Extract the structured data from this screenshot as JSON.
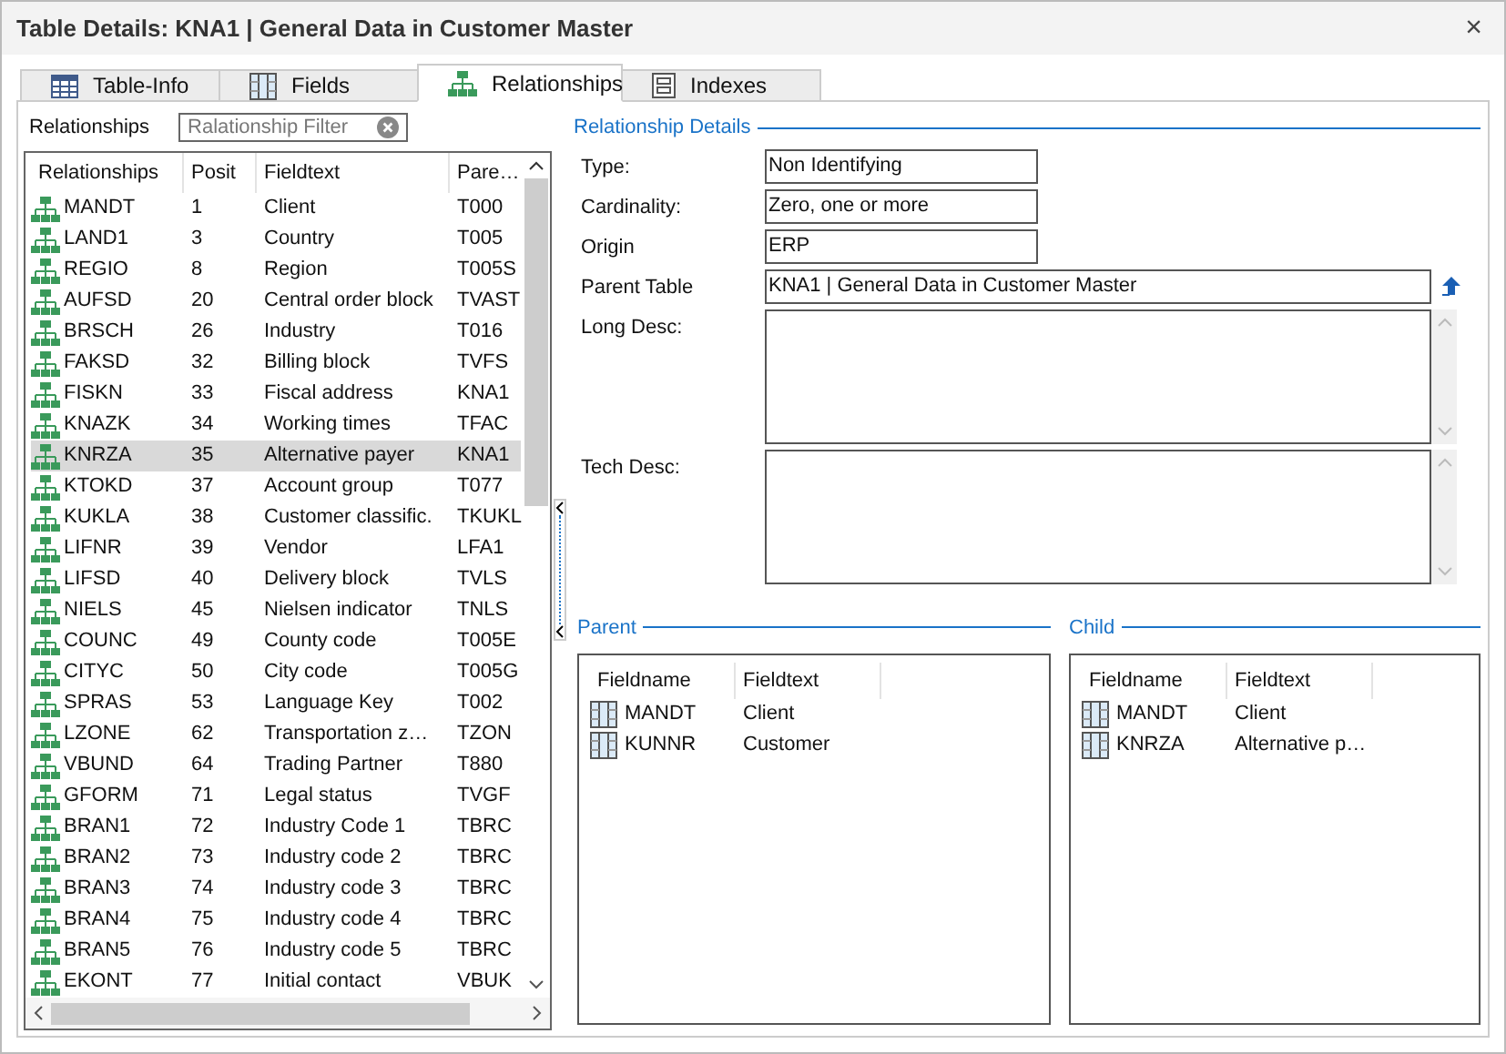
{
  "window": {
    "title": "Table Details: KNA1 | General Data in Customer Master",
    "close": "×"
  },
  "tabs": [
    {
      "label": "Table-Info",
      "kind": "table",
      "selected": false
    },
    {
      "label": "Fields",
      "kind": "fields",
      "selected": false
    },
    {
      "label": "Relationships",
      "kind": "relationships",
      "selected": true
    },
    {
      "label": "Indexes",
      "kind": "indexes",
      "selected": false
    }
  ],
  "relationships_panel": {
    "label": "Relationships",
    "filter": {
      "placeholder": "Ralationship Filter"
    },
    "columns": [
      "Relationships",
      "Posit",
      "Fieldtext",
      "Pare…"
    ],
    "rows": [
      {
        "name": "MANDT",
        "posit": "1",
        "fieldtext": "Client",
        "parent": "T000",
        "selected": false
      },
      {
        "name": "LAND1",
        "posit": "3",
        "fieldtext": "Country",
        "parent": "T005",
        "selected": false
      },
      {
        "name": "REGIO",
        "posit": "8",
        "fieldtext": "Region",
        "parent": "T005S",
        "selected": false
      },
      {
        "name": "AUFSD",
        "posit": "20",
        "fieldtext": "Central order block",
        "parent": "TVAST",
        "selected": false
      },
      {
        "name": "BRSCH",
        "posit": "26",
        "fieldtext": "Industry",
        "parent": "T016",
        "selected": false
      },
      {
        "name": "FAKSD",
        "posit": "32",
        "fieldtext": "Billing block",
        "parent": "TVFS",
        "selected": false
      },
      {
        "name": "FISKN",
        "posit": "33",
        "fieldtext": "Fiscal address",
        "parent": "KNA1",
        "selected": false
      },
      {
        "name": "KNAZK",
        "posit": "34",
        "fieldtext": "Working times",
        "parent": "TFAC",
        "selected": false
      },
      {
        "name": "KNRZA",
        "posit": "35",
        "fieldtext": "Alternative payer",
        "parent": "KNA1",
        "selected": true
      },
      {
        "name": "KTOKD",
        "posit": "37",
        "fieldtext": "Account group",
        "parent": "T077",
        "selected": false
      },
      {
        "name": "KUKLA",
        "posit": "38",
        "fieldtext": "Customer classific.",
        "parent": "TKUKL",
        "selected": false
      },
      {
        "name": "LIFNR",
        "posit": "39",
        "fieldtext": "Vendor",
        "parent": "LFA1",
        "selected": false
      },
      {
        "name": "LIFSD",
        "posit": "40",
        "fieldtext": "Delivery block",
        "parent": "TVLS",
        "selected": false
      },
      {
        "name": "NIELS",
        "posit": "45",
        "fieldtext": "Nielsen indicator",
        "parent": "TNLS",
        "selected": false
      },
      {
        "name": "COUNC",
        "posit": "49",
        "fieldtext": "County code",
        "parent": "T005E",
        "selected": false
      },
      {
        "name": "CITYC",
        "posit": "50",
        "fieldtext": "City code",
        "parent": "T005G",
        "selected": false
      },
      {
        "name": "SPRAS",
        "posit": "53",
        "fieldtext": "Language Key",
        "parent": "T002",
        "selected": false
      },
      {
        "name": "LZONE",
        "posit": "62",
        "fieldtext": "Transportation z…",
        "parent": "TZON",
        "selected": false
      },
      {
        "name": "VBUND",
        "posit": "64",
        "fieldtext": "Trading Partner",
        "parent": "T880",
        "selected": false
      },
      {
        "name": "GFORM",
        "posit": "71",
        "fieldtext": "Legal status",
        "parent": "TVGF",
        "selected": false
      },
      {
        "name": "BRAN1",
        "posit": "72",
        "fieldtext": "Industry Code 1",
        "parent": "TBRC",
        "selected": false
      },
      {
        "name": "BRAN2",
        "posit": "73",
        "fieldtext": "Industry code 2",
        "parent": "TBRC",
        "selected": false
      },
      {
        "name": "BRAN3",
        "posit": "74",
        "fieldtext": "Industry code 3",
        "parent": "TBRC",
        "selected": false
      },
      {
        "name": "BRAN4",
        "posit": "75",
        "fieldtext": "Industry code 4",
        "parent": "TBRC",
        "selected": false
      },
      {
        "name": "BRAN5",
        "posit": "76",
        "fieldtext": "Industry code 5",
        "parent": "TBRC",
        "selected": false
      },
      {
        "name": "EKONT",
        "posit": "77",
        "fieldtext": "Initial contact",
        "parent": "VBUK",
        "selected": false
      }
    ]
  },
  "details": {
    "title": "Relationship Details",
    "fields": [
      {
        "label": "Type:",
        "value": "Non Identifying",
        "kind": "short"
      },
      {
        "label": "Cardinality:",
        "value": "Zero, one or more",
        "kind": "short"
      },
      {
        "label": "Origin",
        "value": "ERP",
        "kind": "short"
      },
      {
        "label": "Parent Table",
        "value": "KNA1 | General Data in Customer Master",
        "kind": "link"
      },
      {
        "label": "Long Desc:",
        "kind": "memo"
      },
      {
        "label": "Tech Desc:",
        "kind": "memo"
      }
    ]
  },
  "parent": {
    "title": "Parent",
    "columns": [
      "Fieldname",
      "Fieldtext"
    ],
    "rows": [
      {
        "fieldname": "MANDT",
        "fieldtext": "Client"
      },
      {
        "fieldname": "KUNNR",
        "fieldtext": "Customer"
      }
    ]
  },
  "child": {
    "title": "Child",
    "columns": [
      "Fieldname",
      "Fieldtext"
    ],
    "rows": [
      {
        "fieldname": "MANDT",
        "fieldtext": "Client"
      },
      {
        "fieldname": "KNRZA",
        "fieldtext": "Alternative p…"
      }
    ]
  }
}
